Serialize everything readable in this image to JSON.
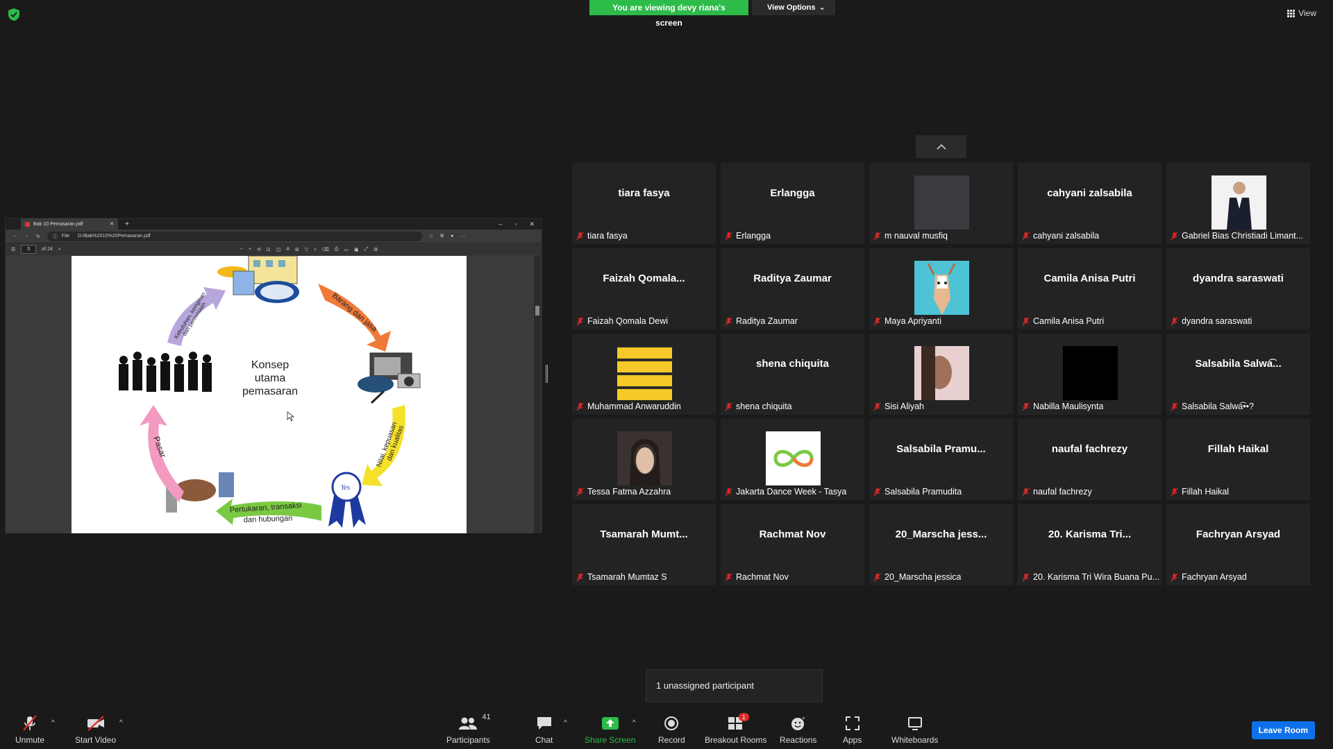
{
  "banner": {
    "viewing": "You are viewing devy riana's screen",
    "view_options": "View Options"
  },
  "view_button": "View",
  "browser": {
    "tab_title": "Bab 10 Pemasaran.pdf",
    "file_label": "File",
    "url": "D:/Bab%2010%20Pemasaran.pdf",
    "page_current": "5",
    "page_total": "of 24"
  },
  "slide": {
    "center_title": "Konsep utama pemasaran",
    "arrows": [
      "Barang dan jasa",
      "Nilai, kepuasan dan kualitas",
      "Pertukaran, transaksi dan hubungan",
      "Pasar",
      "Kebutuhan, keinginan dan permintaan"
    ]
  },
  "participants": [
    {
      "big": "tiara fasya",
      "name": "tiara fasya"
    },
    {
      "big": "Erlangga",
      "name": "Erlangga"
    },
    {
      "big": "",
      "name": "m nauval musfiq",
      "img": "gray"
    },
    {
      "big": "cahyani zalsabila",
      "name": "cahyani zalsabila"
    },
    {
      "big": "",
      "name": "Gabriel Bias Christiadi Limant...",
      "img": "suit"
    },
    {
      "big": "Faizah  Qomala...",
      "name": "Faizah Qomala Dewi"
    },
    {
      "big": "Raditya Zaumar",
      "name": "Raditya Zaumar"
    },
    {
      "big": "",
      "name": "Maya Apriyanti",
      "img": "deer"
    },
    {
      "big": "Camila Anisa Putri",
      "name": "Camila Anisa Putri"
    },
    {
      "big": "dyandra saraswati",
      "name": "dyandra saraswati"
    },
    {
      "big": "",
      "name": "Muhammad Anwaruddin",
      "img": "stripes"
    },
    {
      "big": "shena chiquita",
      "name": "shena chiquita"
    },
    {
      "big": "",
      "name": "Sisi Aliyah",
      "img": "face1"
    },
    {
      "big": "",
      "name": "Nabilla Maulisynta",
      "img": "black"
    },
    {
      "big": "Salsabila  Salwa͡...",
      "name": "Salsabila Salwa͡••?"
    },
    {
      "big": "",
      "name": "Tessa Fatma Azzahra",
      "img": "face2"
    },
    {
      "big": "",
      "name": "Jakarta Dance Week - Tasya",
      "img": "infinity"
    },
    {
      "big": "Salsabila  Pramu...",
      "name": "Salsabila Pramudita"
    },
    {
      "big": "naufal fachrezy",
      "name": "naufal fachrezy"
    },
    {
      "big": "Fillah Haikal",
      "name": "Fillah Haikal"
    },
    {
      "big": "Tsamarah  Mumt...",
      "name": "Tsamarah Mumtaz S"
    },
    {
      "big": "Rachmat Nov",
      "name": "Rachmat Nov"
    },
    {
      "big": "20_Marscha  jess...",
      "name": "20_Marscha jessica"
    },
    {
      "big": "20. Karisma  Tri...",
      "name": "20. Karisma Tri Wira Buana Pu..."
    },
    {
      "big": "Fachryan Arsyad",
      "name": "Fachryan Arsyad"
    }
  ],
  "tooltip": "1 unassigned participant",
  "toolbar": {
    "unmute": "Unmute",
    "start_video": "Start Video",
    "participants": "Participants",
    "participants_count": "41",
    "chat": "Chat",
    "share_screen": "Share Screen",
    "record": "Record",
    "breakout_rooms": "Breakout Rooms",
    "breakout_badge": "1",
    "reactions": "Reactions",
    "apps": "Apps",
    "whiteboards": "Whiteboards",
    "leave": "Leave Room"
  },
  "colors": {
    "green": "#2dbb4a",
    "blue": "#0e71eb",
    "red": "#e02828"
  }
}
